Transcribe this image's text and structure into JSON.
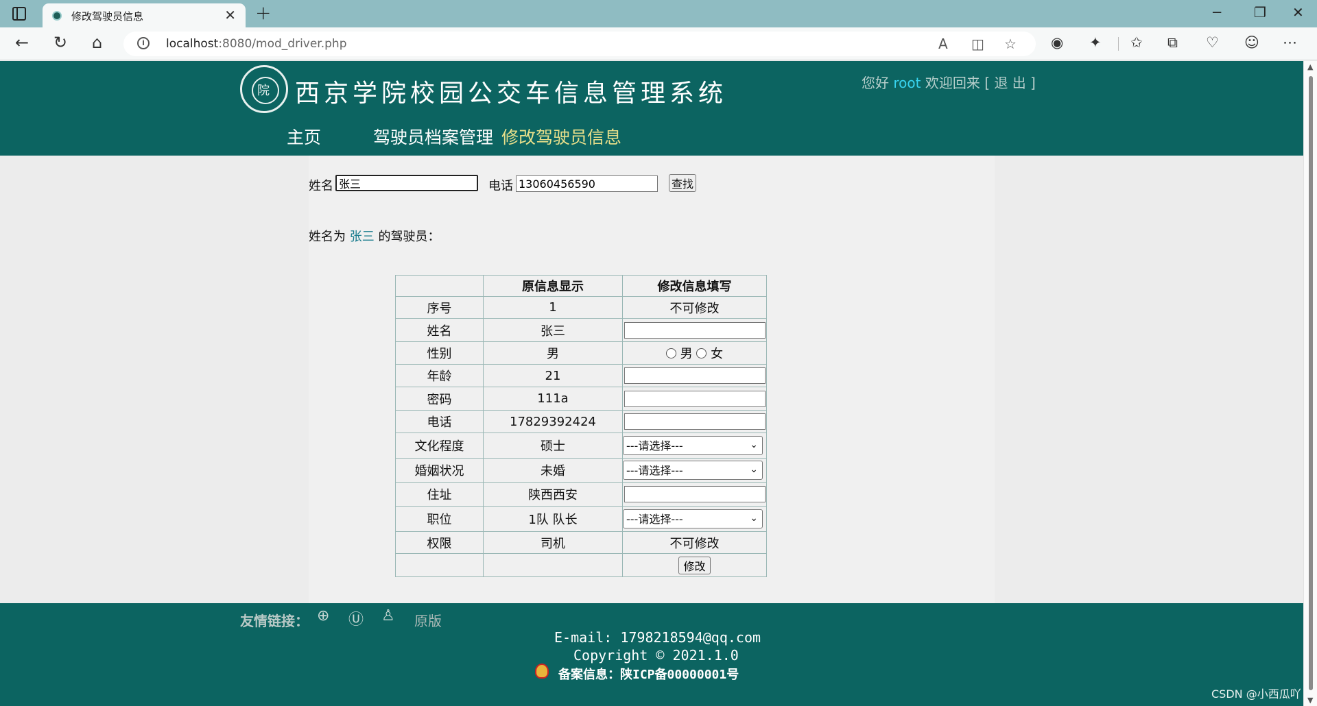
{
  "browser": {
    "tab_title": "修改驾驶员信息",
    "url_host": "localhost",
    "url_rest": ":8080/mod_driver.php"
  },
  "header": {
    "logo_char": "院",
    "site_title": "西京学院校园公交车信息管理系统",
    "greeting": "您好",
    "username": "root",
    "welcome_back": "欢迎回来",
    "logout": "[ 退 出 ]",
    "nav": {
      "home": "主页",
      "driver_records": "驾驶员档案管理",
      "modify_driver": "修改驾驶员信息"
    }
  },
  "search": {
    "name_label": "姓名",
    "name_value": "张三",
    "phone_label": "电话",
    "phone_value": "13060456590",
    "find_button": "查找"
  },
  "result": {
    "prefix": "姓名为",
    "name": "张三",
    "suffix": "的驾驶员："
  },
  "table": {
    "headers": [
      "",
      "原信息显示",
      "修改信息填写"
    ],
    "rows": [
      {
        "field": "序号",
        "original": "1",
        "edit_text": "不可修改"
      },
      {
        "field": "姓名",
        "original": "张三"
      },
      {
        "field": "性别",
        "original": "男",
        "radio_male": "男",
        "radio_female": "女"
      },
      {
        "field": "年龄",
        "original": "21"
      },
      {
        "field": "密码",
        "original": "111a"
      },
      {
        "field": "电话",
        "original": "17829392424"
      },
      {
        "field": "文化程度",
        "original": "硕士",
        "select": "---请选择---"
      },
      {
        "field": "婚姻状况",
        "original": "未婚",
        "select": "---请选择---"
      },
      {
        "field": "住址",
        "original": "陕西西安"
      },
      {
        "field": "职位",
        "original": "1队 队长",
        "select": "---请选择---"
      },
      {
        "field": "权限",
        "original": "司机",
        "edit_text": "不可修改"
      }
    ],
    "submit_button": "修改"
  },
  "footer": {
    "links_label": "友情链接：",
    "link_original": "原版",
    "email_line": "E-mail: 1798218594@qq.com",
    "copyright_line": "Copyright © 2021.1.0",
    "icp_line": "备案信息：陕ICP备00000001号"
  },
  "watermark": "CSDN @小西瓜吖",
  "colors": {
    "header_bg": "#0c6461",
    "nav_active": "#e8df8a",
    "username": "#37d3ef"
  }
}
